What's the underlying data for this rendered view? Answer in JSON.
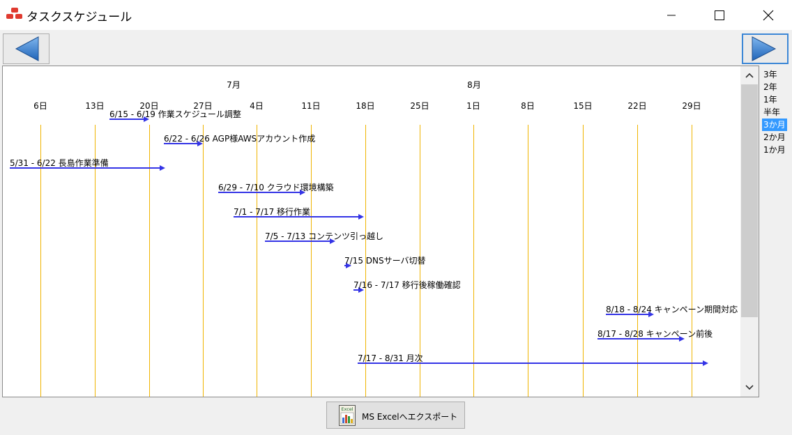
{
  "window": {
    "title": "タスクスケジュール",
    "minimize_icon": "minimize-icon",
    "maximize_icon": "maximize-icon",
    "close_icon": "close-icon"
  },
  "nav": {
    "prev_icon": "triangle-left-icon",
    "next_icon": "triangle-right-icon",
    "arrow_color": "#2f7fd0"
  },
  "timeline": {
    "months": [
      "7月",
      "8月"
    ],
    "days": [
      "6日",
      "13日",
      "20日",
      "27日",
      "4日",
      "11日",
      "18日",
      "25日",
      "1日",
      "8日",
      "15日",
      "22日",
      "29日"
    ],
    "gridline_color": "#f0b400",
    "bar_color": "#3434e6",
    "tasks": [
      {
        "label": "6/15 - 6/19 作業スケジュール調整"
      },
      {
        "label": "6/22 - 6/26 AGP様AWSアカウント作成"
      },
      {
        "label": "5/31 - 6/22 長島作業準備"
      },
      {
        "label": "6/29 - 7/10 クラウド環境構築"
      },
      {
        "label": "7/1 - 7/17 移行作業"
      },
      {
        "label": "7/5 - 7/13 コンテンツ引っ越し"
      },
      {
        "label": "7/15 DNSサーバ切替"
      },
      {
        "label": "7/16 - 7/17 移行後稼働確認"
      },
      {
        "label": "8/18 - 8/24 キャンペーン期間対応"
      },
      {
        "label": "8/17 - 8/28 キャンペーン前後"
      },
      {
        "label": "7/17 - 8/31 月次"
      }
    ]
  },
  "range_options": [
    "3年",
    "2年",
    "1年",
    "半年",
    "3か月",
    "2か月",
    "1か月"
  ],
  "selected_range": "3か月",
  "export": {
    "label": "MS Excelへエクスポート",
    "icon_text": "Excel"
  }
}
